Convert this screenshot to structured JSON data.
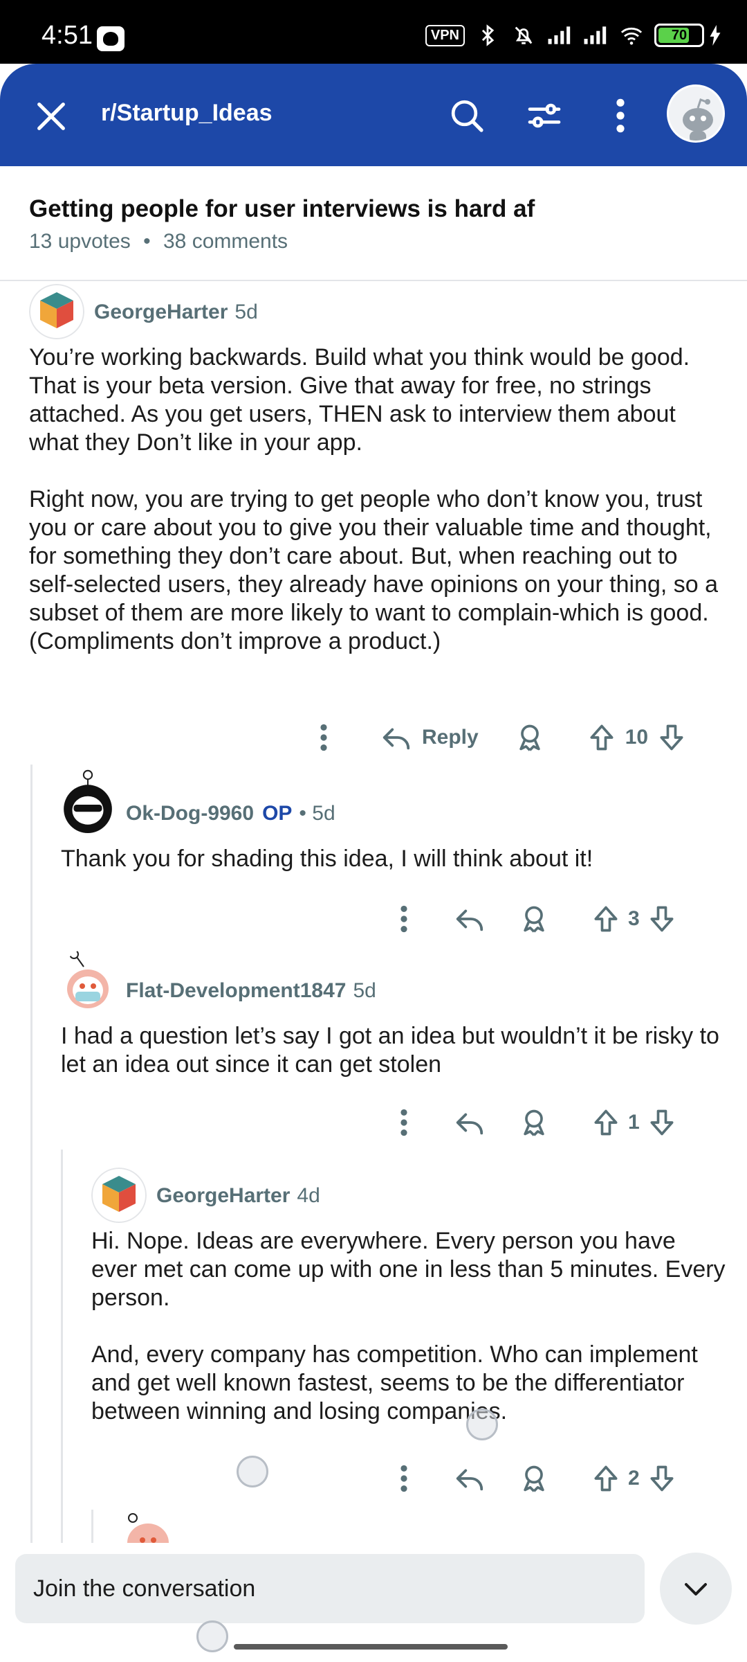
{
  "status": {
    "time": "4:51",
    "vpn": "VPN",
    "battery": "70"
  },
  "header": {
    "subreddit": "r/Startup_Ideas"
  },
  "post": {
    "title": "Getting people for user interviews is hard af",
    "upvotes": "13 upvotes",
    "comments": "38 comments"
  },
  "comments": [
    {
      "user": "GeorgeHarter",
      "age": "5d",
      "text": "You’re working backwards. Build what you think would be good. That is your beta version. Give that away for free, no strings attached. As you get users, THEN ask to interview them about what they Don’t like in your app.\n\nRight now, you are trying to get people who don’t know you, trust you or care about you to give you their valuable time and thought, for something they don’t care about. But, when reaching out to self-selected users, they already have opinions on your thing, so a subset of them are more likely to want to complain-which is good. (Compliments don’t improve a product.)",
      "reply_label": "Reply",
      "score": "10"
    },
    {
      "user": "Ok-Dog-9960",
      "op": "OP",
      "age": "• 5d",
      "text": "Thank you for shading this idea, I will think about it!",
      "score": "3"
    },
    {
      "user": "Flat-Development1847",
      "age": "5d",
      "text": "I had a question let’s say I got an idea but wouldn’t it be risky to let an idea out since it can get stolen",
      "score": "1"
    },
    {
      "user": "GeorgeHarter",
      "age": "4d",
      "text": "Hi. Nope. Ideas are everywhere. Every person you have ever met can come up with one in less than 5 minutes. Every person.\n\nAnd, every company has competition. Who can implement and get well known fastest, seems to be the differentiator between winning and losing companies.",
      "score": "2"
    }
  ],
  "composer": {
    "placeholder": "Join the conversation"
  }
}
